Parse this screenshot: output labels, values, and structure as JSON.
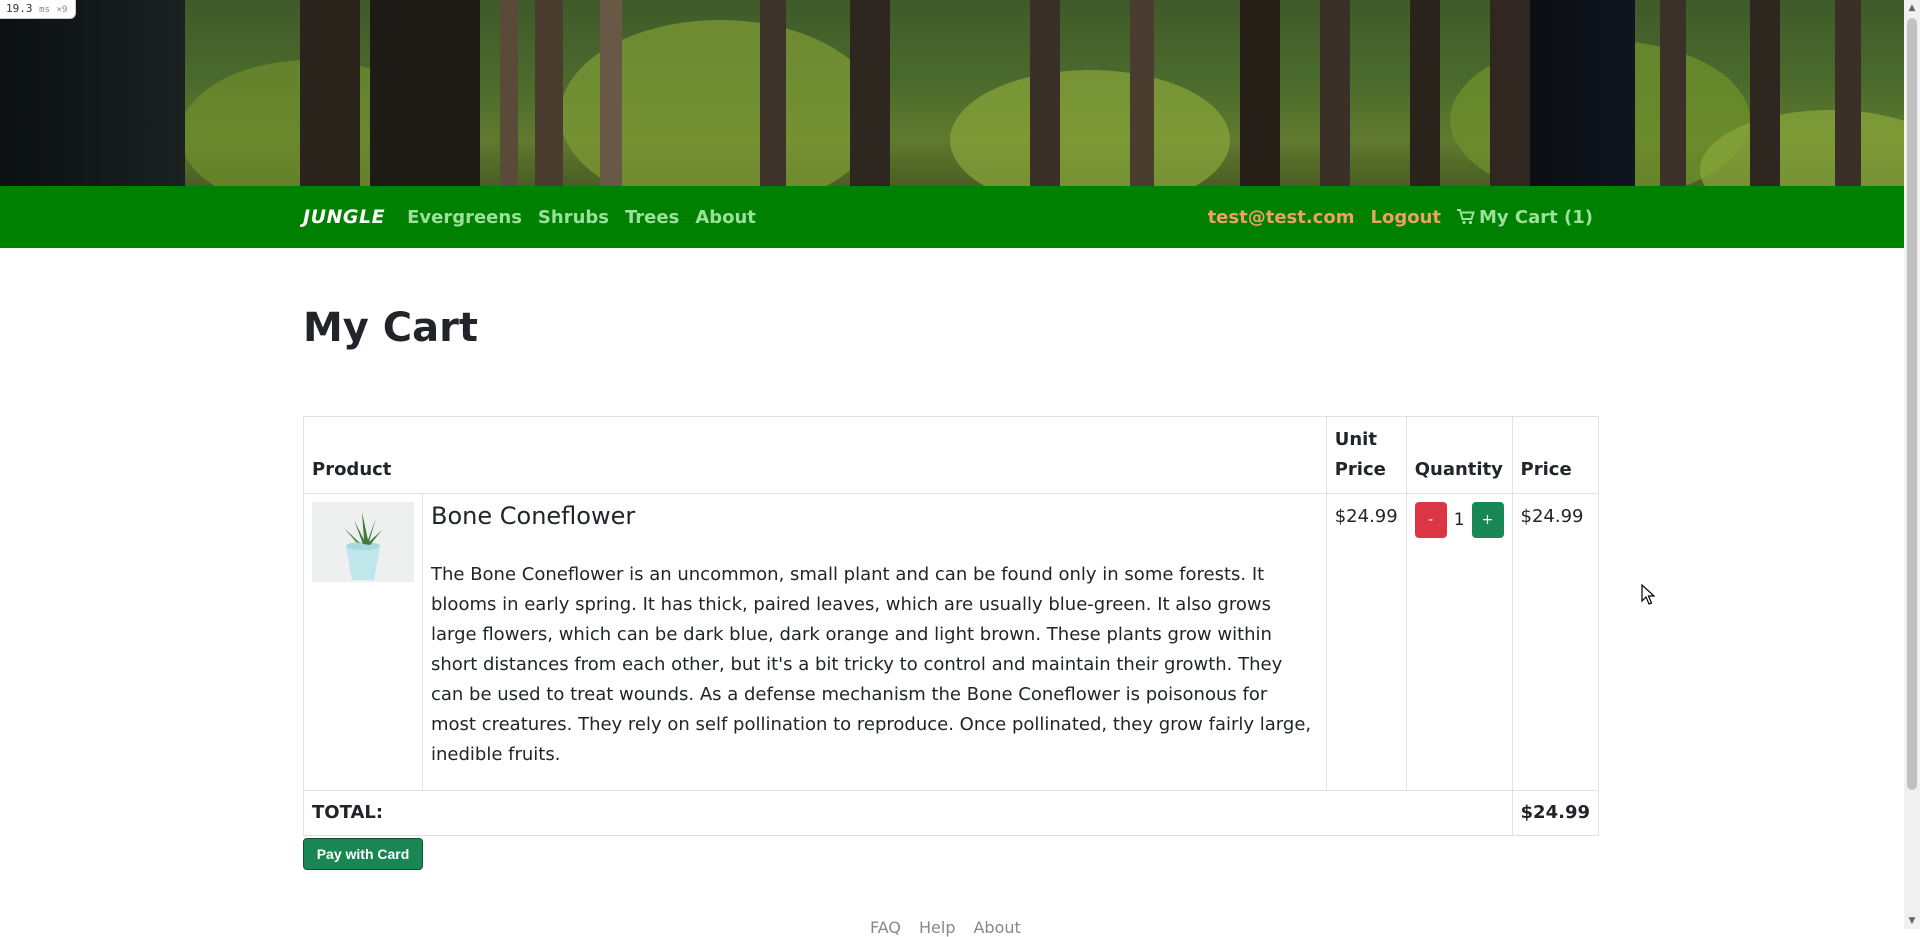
{
  "perf": {
    "value": "19.3",
    "unit": "ms",
    "suffix": "×9"
  },
  "navbar": {
    "brand": "JUNGLE",
    "links": [
      "Evergreens",
      "Shrubs",
      "Trees",
      "About"
    ],
    "user": "test@test.com",
    "logout": "Logout",
    "cart": "My Cart (1)"
  },
  "page": {
    "title": "My Cart"
  },
  "table": {
    "headers": {
      "product": "Product",
      "unit_price": "Unit Price",
      "quantity": "Quantity",
      "price": "Price"
    },
    "items": [
      {
        "name": "Bone Coneflower",
        "description": "The Bone Coneflower is an uncommon, small plant and can be found only in some forests. It blooms in early spring. It has thick, paired leaves, which are usually blue-green. It also grows large flowers, which can be dark blue, dark orange and light brown. These plants grow within short distances from each other, but it's a bit tricky to control and maintain their growth. They can be used to treat wounds. As a defense mechanism the Bone Coneflower is poisonous for most creatures. They rely on self pollination to reproduce. Once pollinated, they grow fairly large, inedible fruits.",
        "unit_price": "$24.99",
        "quantity": "1",
        "minus": "-",
        "plus": "+",
        "price": "$24.99"
      }
    ],
    "total_label": "TOTAL:",
    "total": "$24.99"
  },
  "pay_button": "Pay with Card",
  "footer": [
    "FAQ",
    "Help",
    "About"
  ],
  "colors": {
    "navbar": "#008000",
    "nav_link": "#9be09b",
    "user_link": "#f0a060",
    "minus": "#dc3545",
    "plus": "#198754"
  }
}
